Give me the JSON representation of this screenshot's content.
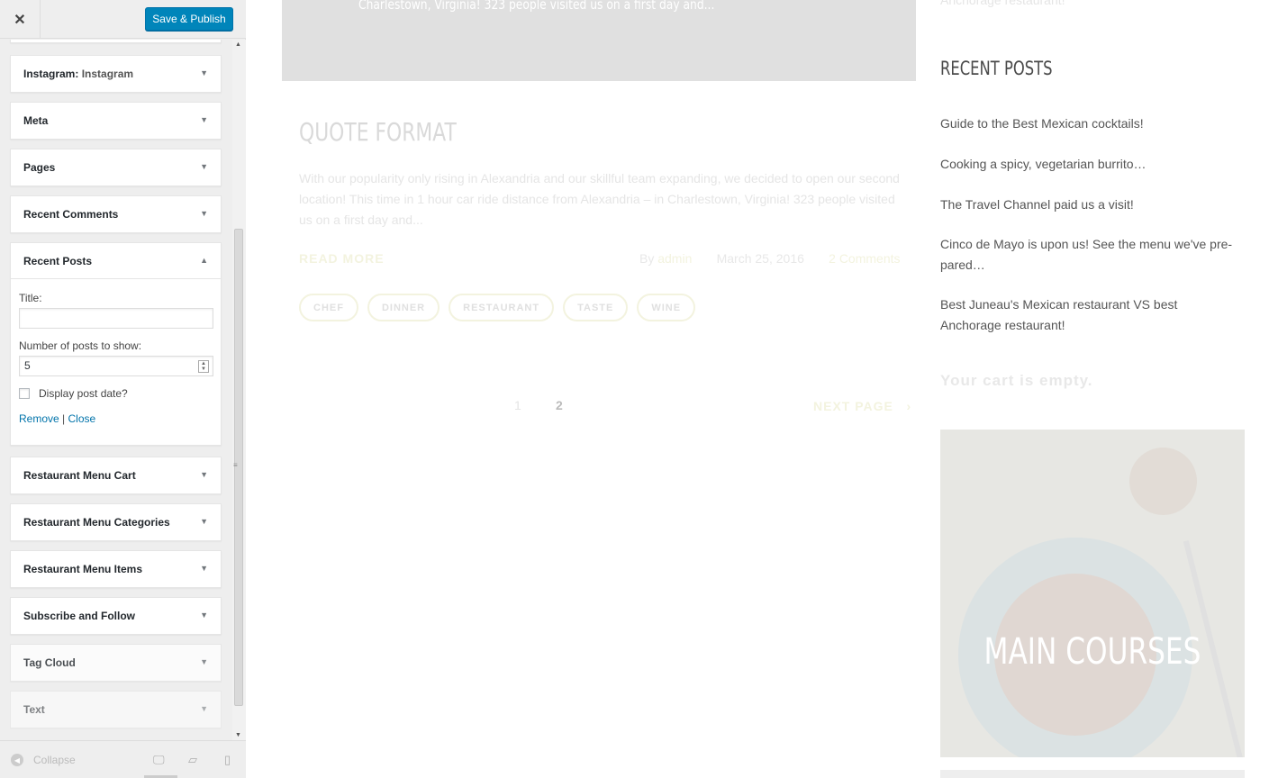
{
  "header": {
    "close_icon": "close-icon",
    "publish_label": "Save & Publish",
    "publish_color": "#0085ba"
  },
  "widgets": [
    {
      "title": "Instagram:",
      "subtitle": "Instagram"
    },
    {
      "title": "Meta"
    },
    {
      "title": "Pages"
    },
    {
      "title": "Recent Comments"
    }
  ],
  "recent_posts": {
    "title": "Recent Posts",
    "title_label": "Title:",
    "title_value": "",
    "count_label": "Number of posts to show:",
    "count_value": "5",
    "display_date_label": "Display post date?",
    "remove_label": "Remove",
    "separator": "|",
    "close_label": "Close"
  },
  "widgets_after": [
    {
      "title": "Restaurant Menu Cart"
    },
    {
      "title": "Restaurant Menu Categories"
    },
    {
      "title": "Restaurant Menu Items"
    },
    {
      "title": "Subscribe and Follow"
    },
    {
      "title": "Tag Cloud"
    },
    {
      "title": "Text"
    }
  ],
  "footer": {
    "collapse_label": "Collapse",
    "devices": [
      "desktop-icon",
      "tablet-icon",
      "mobile-icon"
    ]
  },
  "preview": {
    "featured_excerpt": "Charlestown, Virginia! 323 people visited us on a first day and...",
    "post_title": "QUOTE FORMAT",
    "excerpt": "With our popularity only rising in Alexandria and our skillful team expanding, we decided to open our second location! This time in 1 hour car ride distance from Alexandria – in Charlestown, Virginia! 323 people visited us on a first day and...",
    "read_more": "READ MORE",
    "by": "By",
    "author": "admin",
    "date": "March 25, 2016",
    "comments": "2 Comments",
    "tags": [
      "CHEF",
      "DINNER",
      "RESTAURANT",
      "TASTE",
      "WINE"
    ],
    "pagination": {
      "page1": "1",
      "page2": "2",
      "next": "NEXT PAGE",
      "next_arrow": "›"
    },
    "sidebar": {
      "prev_text": "Anchorage restaurant!",
      "recent_posts_heading": "RECENT POSTS",
      "recent_posts": [
        "Guide to the Best Mexican cocktails!",
        "Cooking a spicy, vegetarian burrito…",
        "The Travel Channel paid us a visit!",
        "Cinco de Mayo is upon us! See the menu we've pre-pared…",
        "Best Juneau's Mexican restaurant VS best Anchorage restaurant!"
      ],
      "cart_empty": "Your cart is empty.",
      "courses_title": "MAIN COURSES"
    }
  }
}
